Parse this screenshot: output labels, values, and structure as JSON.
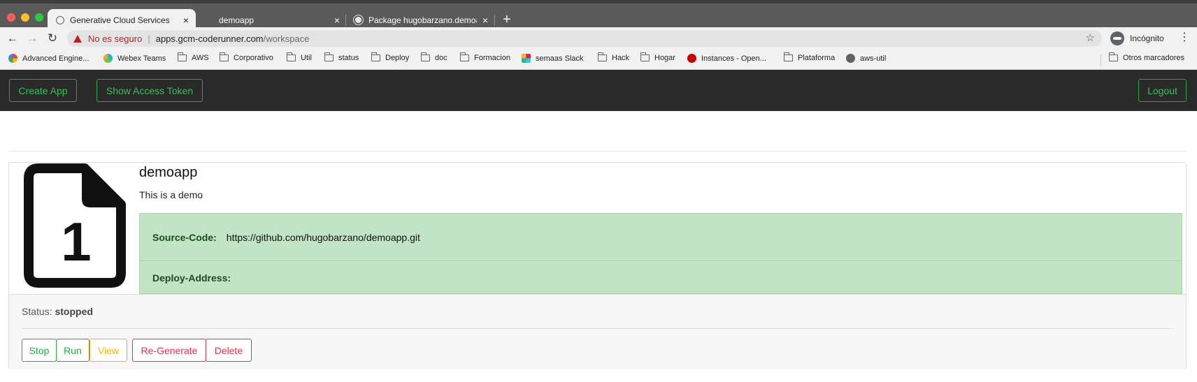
{
  "browser": {
    "tabs": [
      {
        "label": "Generative Cloud Services",
        "active": true,
        "icon": "globe-icon"
      },
      {
        "label": "demoapp",
        "active": false,
        "icon": ""
      },
      {
        "label": "Package hugobarzano.demoapp",
        "active": false,
        "icon": "github-icon"
      }
    ],
    "new_tab": "+",
    "close_glyph": "×",
    "security_text": "No es seguro",
    "url_host": "apps.gcm-coderunner.com",
    "url_path": "/workspace",
    "profile_label": "Incógnito",
    "bookmarks": [
      {
        "label": "Advanced Engine...",
        "icon": "google-icon"
      },
      {
        "label": "Webex Teams",
        "icon": "webex-icon"
      },
      {
        "label": "AWS",
        "icon": "folder-icon"
      },
      {
        "label": "Corporativo",
        "icon": "folder-icon"
      },
      {
        "label": "Util",
        "icon": "folder-icon"
      },
      {
        "label": "status",
        "icon": "folder-icon"
      },
      {
        "label": "Deploy",
        "icon": "folder-icon"
      },
      {
        "label": "doc",
        "icon": "folder-icon"
      },
      {
        "label": "Formacion",
        "icon": "folder-icon"
      },
      {
        "label": "semaas Slack",
        "icon": "slack-icon"
      },
      {
        "label": "Hack",
        "icon": "folder-icon"
      },
      {
        "label": "Hogar",
        "icon": "folder-icon"
      },
      {
        "label": "Instances - Open...",
        "icon": "redhat-icon"
      },
      {
        "label": "Plataforma",
        "icon": "folder-icon"
      },
      {
        "label": "aws-util",
        "icon": "globe-icon"
      }
    ],
    "other_bookmarks": "Otros marcadores"
  },
  "header": {
    "create_app": "Create App",
    "show_token": "Show Access Token",
    "logout": "Logout"
  },
  "app_card": {
    "icon_number": "1",
    "name": "demoapp",
    "description": "This is a demo",
    "source_label": "Source-Code:",
    "source_value": "https://github.com/hugobarzano/demoapp.git",
    "deploy_label": "Deploy-Address:",
    "deploy_value": "",
    "status_label": "Status:",
    "status_value": "stopped",
    "actions": {
      "stop": "Stop",
      "run": "Run",
      "view": "View",
      "regenerate": "Re-Generate",
      "delete": "Delete"
    }
  },
  "colors": {
    "header_bg": "#2a2a2a",
    "success": "#28a745",
    "warning": "#f0b400",
    "danger": "#dc3545",
    "info_box_bg": "#c0e4c4"
  }
}
